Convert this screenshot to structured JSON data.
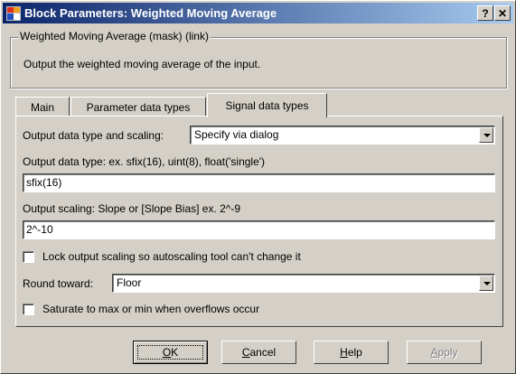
{
  "window": {
    "title": "Block Parameters: Weighted Moving Average",
    "help_button": "?",
    "close_button": "✕"
  },
  "group": {
    "legend": "Weighted Moving Average (mask) (link)",
    "description": "Output the weighted moving average of the input."
  },
  "tabs": [
    {
      "label": "Main"
    },
    {
      "label": "Parameter data types"
    },
    {
      "label": "Signal data types"
    }
  ],
  "panel": {
    "output_type_scaling_label": "Output data type and scaling:",
    "output_type_scaling_value": "Specify via dialog",
    "output_data_type_label": "Output data type:    ex. sfix(16),  uint(8),  float('single')",
    "output_data_type_value": "sfix(16)",
    "output_scaling_label": "Output scaling:   Slope or [Slope Bias]   ex.  2^-9",
    "output_scaling_value": "2^-10",
    "lock_scaling_label": "Lock output scaling so autoscaling tool can't change it",
    "lock_scaling_checked": false,
    "round_toward_label": "Round toward:",
    "round_toward_value": "Floor",
    "saturate_label": "Saturate to max or min when overflows occur",
    "saturate_checked": false
  },
  "buttons": {
    "ok": {
      "pre": "",
      "ul": "O",
      "post": "K"
    },
    "cancel": {
      "pre": "",
      "ul": "C",
      "post": "ancel"
    },
    "help": {
      "pre": "",
      "ul": "H",
      "post": "elp"
    },
    "apply": {
      "pre": "",
      "ul": "A",
      "post": "pply"
    }
  },
  "colors": {
    "title_start": "#0a246a",
    "title_end": "#a6caf0",
    "face": "#d4d0c8"
  }
}
